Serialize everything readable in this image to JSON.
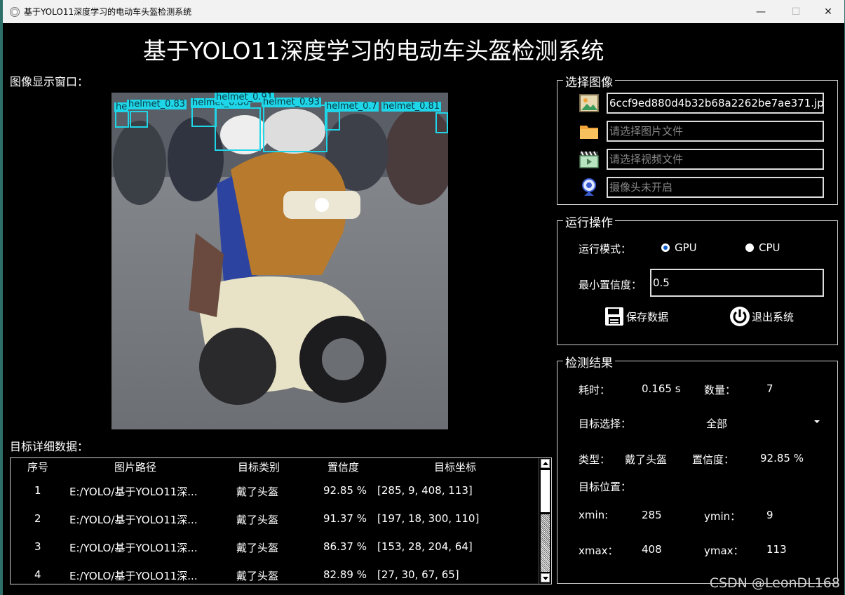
{
  "window": {
    "title": "基于YOLO11深度学习的电动车头盔检测系统",
    "controls": {
      "minimize": "—",
      "maximize": "☐",
      "close": "✕"
    }
  },
  "header": {
    "title": "基于YOLO11深度学习的电动车头盔检测系统"
  },
  "image_panel": {
    "label": "图像显示窗口：",
    "detections": [
      {
        "text": "helmet_0.83"
      },
      {
        "text": "helmet_0.86"
      },
      {
        "text": "helmet_0.91"
      },
      {
        "text": "helmet_0.93"
      },
      {
        "text": "helmet_0.7"
      },
      {
        "text": "helmet_0.81"
      },
      {
        "text": "he"
      }
    ]
  },
  "select_image": {
    "title": "选择图像",
    "image_path": "6ccf9ed880d4b32b68a2262be7ae371.jpg",
    "image_placeholder": "请选择图片文件",
    "video_placeholder": "请选择视频文件",
    "camera_placeholder": "摄像头未开启"
  },
  "operations": {
    "title": "运行操作",
    "mode_label": "运行模式：",
    "gpu_label": "GPU",
    "cpu_label": "CPU",
    "selected_mode": "GPU",
    "conf_label": "最小置信度：",
    "conf_value": "0.5",
    "save_label": "保存数据",
    "exit_label": "退出系统"
  },
  "results": {
    "title": "检测结果",
    "time_label": "耗时：",
    "time_value": "0.165 s",
    "count_label": "数量：",
    "count_value": "7",
    "target_label": "目标选择：",
    "target_value": "全部",
    "type_label": "类型：",
    "type_value": "戴了头盔",
    "conf_label": "置信度：",
    "conf_value": "92.85 %",
    "pos_label": "目标位置：",
    "xmin_label": "xmin:",
    "xmin_value": "285",
    "ymin_label": "ymin：",
    "ymin_value": "9",
    "xmax_label": "xmax：",
    "xmax_value": "408",
    "ymax_label": "ymax：",
    "ymax_value": "113"
  },
  "table": {
    "label": "目标详细数据：",
    "headers": [
      "序号",
      "图片路径",
      "目标类别",
      "置信度",
      "目标坐标"
    ],
    "rows": [
      [
        "1",
        "E:/YOLO/基于YOLO11深...",
        "戴了头盔",
        "92.85 %",
        "[285, 9, 408, 113]"
      ],
      [
        "2",
        "E:/YOLO/基于YOLO11深...",
        "戴了头盔",
        "91.37 %",
        "[197, 18, 300, 110]"
      ],
      [
        "3",
        "E:/YOLO/基于YOLO11深...",
        "戴了头盔",
        "86.37 %",
        "[153, 28, 204, 64]"
      ],
      [
        "4",
        "E:/YOLO/基于YOLO11深...",
        "戴了头盔",
        "82.89 %",
        "[27, 30, 67, 65]"
      ]
    ]
  },
  "watermark": "CSDN @LeonDL168"
}
